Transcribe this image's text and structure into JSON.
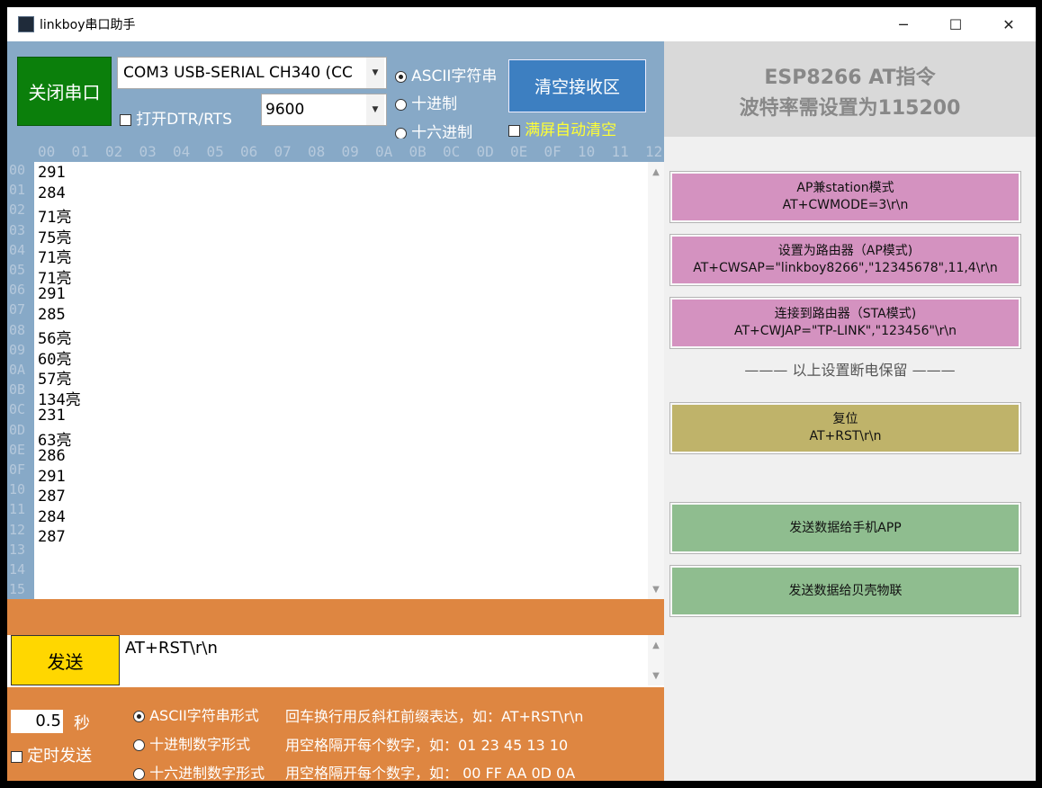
{
  "window": {
    "title": "linkboy串口助手",
    "controls": {
      "minimize": "─",
      "maximize": "☐",
      "close": "✕"
    }
  },
  "toolbar": {
    "close_port_label": "关闭串口",
    "port_value": "COM3 USB-SERIAL CH340 (CC",
    "dtr_rts_label": "打开DTR/RTS",
    "baud_value": "9600",
    "display_modes": [
      {
        "label": "ASCII字符串",
        "selected": true
      },
      {
        "label": "十进制",
        "selected": false
      },
      {
        "label": "十六进制",
        "selected": false
      }
    ],
    "clear_label": "清空接收区",
    "autoclear_label": "满屏自动清空"
  },
  "receive": {
    "col_headers": [
      "00",
      "01",
      "02",
      "03",
      "04",
      "05",
      "06",
      "07",
      "08",
      "09",
      "0A",
      "0B",
      "0C",
      "0D",
      "0E",
      "0F",
      "10",
      "11",
      "12"
    ],
    "row_numbers": [
      "00",
      "01",
      "02",
      "03",
      "04",
      "05",
      "06",
      "07",
      "08",
      "09",
      "0A",
      "0B",
      "0C",
      "0D",
      "0E",
      "0F",
      "10",
      "11",
      "12",
      "13",
      "14",
      "15"
    ],
    "lines": [
      "291",
      "284",
      "71亮",
      "75亮",
      "71亮",
      "71亮",
      "291",
      "285",
      "56亮",
      "60亮",
      "57亮",
      "134亮",
      "231",
      "63亮",
      "286",
      "291",
      "287",
      "284",
      "287"
    ]
  },
  "send": {
    "button_label": "发送",
    "input_value": "AT+RST\\r\\n",
    "interval_value": "0.5",
    "interval_unit": "秒",
    "timed_send_label": "定时发送",
    "formats": [
      {
        "label": "ASCII字符串形式",
        "hint": "回车换行用反斜杠前缀表达，如：AT+RST\\r\\n",
        "selected": true
      },
      {
        "label": "十进制数字形式",
        "hint": "用空格隔开每个数字，如：01 23 45 13 10",
        "selected": false
      },
      {
        "label": "十六进制数字形式",
        "hint": "用空格隔开每个数字，如：  00 FF AA 0D 0A",
        "selected": false
      }
    ]
  },
  "right_panel": {
    "title_line1": "ESP8266 AT指令",
    "title_line2": "波特率需设置为115200",
    "separator_text": "——— 以上设置断电保留 ———",
    "buttons": [
      {
        "line1": "AP兼station模式",
        "line2": "AT+CWMODE=3\\r\\n",
        "color": "#d492c0"
      },
      {
        "line1": "设置为路由器（AP模式)",
        "line2": "AT+CWSAP=\"linkboy8266\",\"12345678\",11,4\\r\\n",
        "color": "#d492c0"
      },
      {
        "line1": "连接到路由器（STA模式)",
        "line2": "AT+CWJAP=\"TP-LINK\",\"123456\"\\r\\n",
        "color": "#d492c0"
      },
      {
        "line1": "复位",
        "line2": "AT+RST\\r\\n",
        "color": "#bfb36a"
      },
      {
        "line1": "发送数据给手机APP",
        "color": "#8fbd8f"
      },
      {
        "line1": "发送数据给贝壳物联",
        "color": "#8fbd8f"
      }
    ]
  },
  "colors": {
    "toolbar_bg": "#87a9c7",
    "close_port_bg": "#0b7f0b",
    "clear_bg": "#3d7fc1",
    "send_bg": "#ffd700",
    "orange": "#de8641",
    "autoclear_text": "#ffff33"
  }
}
